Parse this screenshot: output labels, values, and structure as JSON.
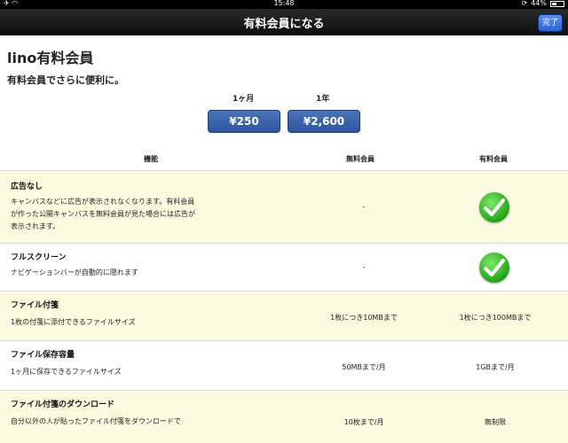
{
  "status": {
    "time": "15:48",
    "battery": "44%"
  },
  "nav": {
    "title": "有料会員になる",
    "done": "完了"
  },
  "header": {
    "title": "lino有料会員",
    "subtitle": "有料会員でさらに便利に。"
  },
  "plans": [
    {
      "label": "1ヶ月",
      "price": "¥250"
    },
    {
      "label": "1年",
      "price": "¥2,600"
    }
  ],
  "table": {
    "headers": {
      "feature": "機能",
      "free": "無料会員",
      "paid": "有料会員"
    },
    "rows": [
      {
        "title": "広告なし",
        "desc": "キャンバスなどに広告が表示されなくなります。有料会員が作った公開キャンバスを無料会員が見た場合には広告が表示されます。",
        "free": "-",
        "paid": "check"
      },
      {
        "title": "フルスクリーン",
        "desc": "ナビゲーションバーが自動的に隠れます",
        "free": "-",
        "paid": "check"
      },
      {
        "title": "ファイル付箋",
        "desc": "1枚の付箋に添付できるファイルサイズ",
        "free": "1枚につき10MBまで",
        "paid": "1枚につき100MBまで"
      },
      {
        "title": "ファイル保存容量",
        "desc": "1ヶ月に保存できるファイルサイズ",
        "free": "50MBまで/月",
        "paid": "1GBまで/月"
      },
      {
        "title": "ファイル付箋のダウンロード",
        "desc": "自分以外の人が貼ったファイル付箋をダウンロードで",
        "free": "10枚まで/月",
        "paid": "無制限"
      }
    ]
  },
  "colors": {
    "row_alt": "#fbfbe0",
    "price_button": "#3a64ad",
    "done_button": "#3a77e6",
    "check": "#2fb524"
  }
}
